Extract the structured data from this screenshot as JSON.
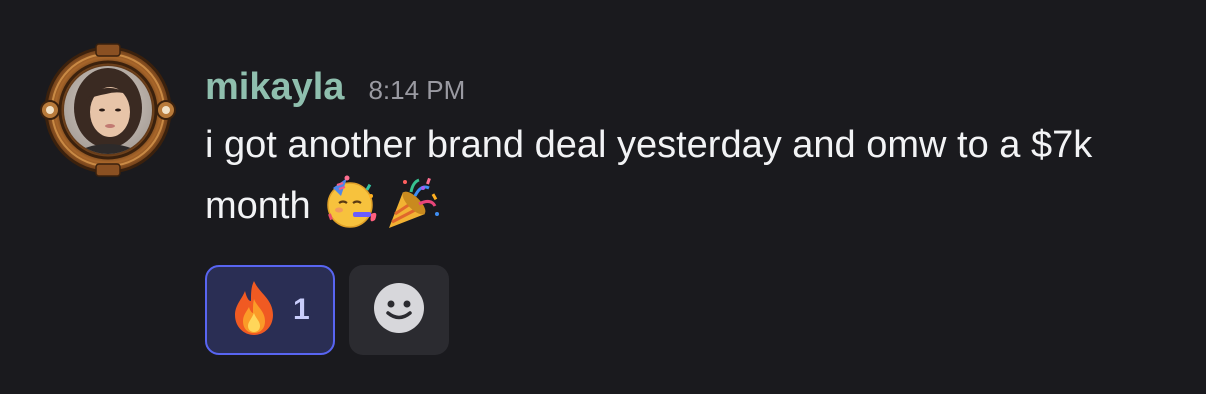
{
  "message": {
    "username": "mikayla",
    "timestamp": "8:14 PM",
    "text": "i got another brand deal yesterday and omw to a $7k month",
    "trailing_emojis": [
      "partying-face-emoji",
      "party-popper-emoji"
    ]
  },
  "reactions": [
    {
      "emoji": "fire-icon",
      "count": "1",
      "active": true
    }
  ],
  "add_reaction_icon": "smiley-icon",
  "colors": {
    "background": "#1a1a1e",
    "username": "#8fbfae",
    "timestamp": "#9a9aa2",
    "text": "#f2f3f5",
    "reaction_active_bg": "#2a2e54",
    "reaction_active_border": "#5865f2",
    "add_reaction_bg": "#2b2b30"
  }
}
